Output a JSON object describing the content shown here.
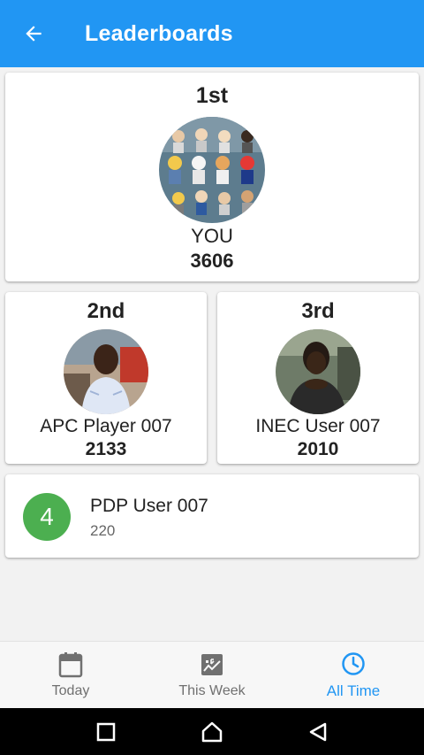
{
  "appbar": {
    "title": "Leaderboards",
    "back_icon": "arrow-left-icon"
  },
  "colors": {
    "primary": "#2196f3",
    "rank_badge": "#4caf50"
  },
  "first": {
    "rank": "1st",
    "name": "YOU",
    "score": "3606"
  },
  "second": {
    "rank": "2nd",
    "name": "APC Player 007",
    "score": "2133"
  },
  "third": {
    "rank": "3rd",
    "name": "INEC User 007",
    "score": "2010"
  },
  "others": [
    {
      "rank": "4",
      "name": "PDP User 007",
      "score": "220"
    }
  ],
  "bottom_nav": {
    "items": [
      {
        "label": "Today",
        "icon": "calendar-icon",
        "active": false
      },
      {
        "label": "This Week",
        "icon": "week-icon",
        "active": false
      },
      {
        "label": "All Time",
        "icon": "clock-icon",
        "active": true
      }
    ]
  },
  "system_nav": {
    "icons": [
      "recents-icon",
      "home-icon",
      "back-icon"
    ]
  }
}
